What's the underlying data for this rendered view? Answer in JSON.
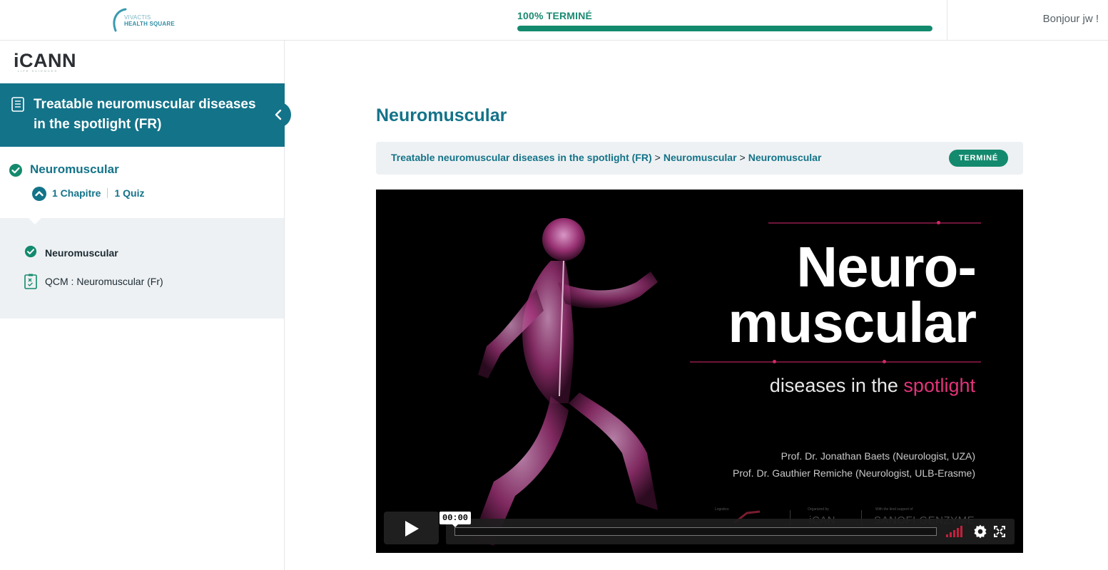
{
  "header": {
    "brand_line1": "VIVACTIS",
    "brand_line2": "HEALTH SQUARE",
    "progress_label": "100% TERMINÉ",
    "progress_fraction": 1.0,
    "greeting": "Bonjour jw !"
  },
  "sidebar": {
    "logo": "iCANN",
    "logo_tagline": "LIFE SCIENCES",
    "course_title": "Treatable neuromuscular diseases in the spotlight (FR)",
    "section": {
      "title": "Neuromuscular",
      "chapters": "1 Chapitre",
      "quizzes": "1 Quiz"
    },
    "items": [
      {
        "label": "Neuromuscular",
        "icon": "check-circle-icon"
      },
      {
        "label": "QCM : Neuromuscular (Fr)",
        "icon": "quiz-clipboard-icon"
      }
    ]
  },
  "main": {
    "title": "Neuromuscular",
    "breadcrumb": [
      "Treatable neuromuscular diseases in the spotlight (FR)",
      "Neuromuscular",
      "Neuromuscular"
    ],
    "breadcrumb_separator": ">",
    "status": "TERMINÉ"
  },
  "video": {
    "slide_title_line1": "Neuro-",
    "slide_title_line2": "muscular",
    "slide_sub_plain": "diseases in the ",
    "slide_sub_accent": "spotlight",
    "author1": "Prof. Dr. Jonathan Baets (Neurologist, UZA)",
    "author2": "Prof. Dr. Gauthier Remiche (Neurologist, ULB-Erasme)",
    "logo_caption1": "Logistics",
    "logo_caption2": "Organized by",
    "logo_caption3": "With the kind support of",
    "logo_org": "iCAN",
    "logo_sponsor": "SANOFI GENZYME",
    "current_time": "00:00",
    "progress_fraction": 0.0
  },
  "colors": {
    "primary": "#137389",
    "success": "#138a6e",
    "accent_pink": "#e2337a"
  }
}
